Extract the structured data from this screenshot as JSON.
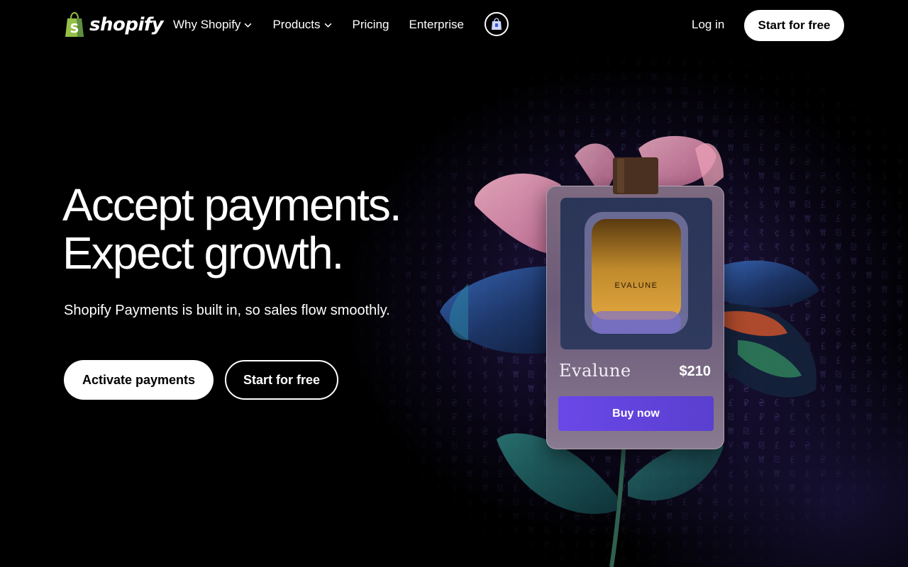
{
  "brand": {
    "name": "shopify",
    "accent": "#95bf47"
  },
  "nav": {
    "items": [
      {
        "label": "Why Shopify",
        "has_dropdown": true
      },
      {
        "label": "Products",
        "has_dropdown": true
      },
      {
        "label": "Pricing",
        "has_dropdown": false
      },
      {
        "label": "Enterprise",
        "has_dropdown": false
      }
    ],
    "store_icon": "shopping-bag-icon",
    "login_label": "Log in",
    "cta_label": "Start for free"
  },
  "hero": {
    "headline_line1": "Accept payments.",
    "headline_line2": "Expect growth.",
    "subheadline": "Shopify Payments is built in, so sales flow smoothly.",
    "primary_cta": "Activate payments",
    "secondary_cta": "Start for free"
  },
  "product_card": {
    "bottle_label": "EVALUNE",
    "name": "Evalune",
    "price": "$210",
    "buy_label": "Buy now",
    "button_color": "#6a48e8"
  },
  "colors": {
    "background": "#000000",
    "text": "#ffffff",
    "glow": "#463296"
  }
}
